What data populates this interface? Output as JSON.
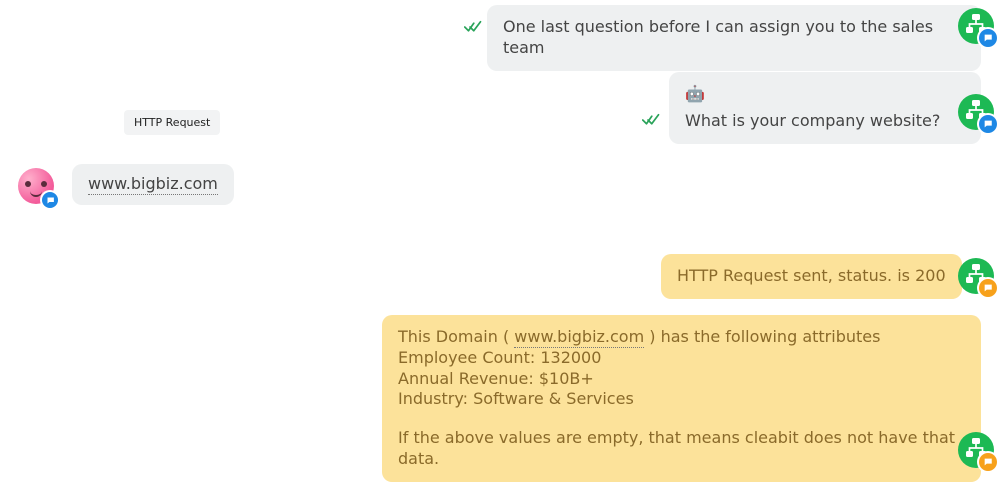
{
  "messages": {
    "bot1": {
      "text": "One last question before I can assign you to the sales team"
    },
    "bot2": {
      "emoji": "🤖",
      "text": "What is your company website?"
    },
    "chip": {
      "label": "HTTP Request"
    },
    "user1": {
      "text": "www.bigbiz.com"
    },
    "status": {
      "text": "HTTP Request sent, status. is 200"
    },
    "detail": {
      "intro_prefix": "This Domain ( ",
      "domain": "www.bigbiz.com",
      "intro_suffix": " ) has the following attributes",
      "employee_label": "Employee Count: ",
      "employee_value": "132000",
      "revenue_label": "Annual Revenue: ",
      "revenue_value": "$10B+",
      "industry_label": "Industry: ",
      "industry_value": "Software & Services",
      "footer": "If the above values are empty, that means cleabit does not have that data."
    }
  }
}
